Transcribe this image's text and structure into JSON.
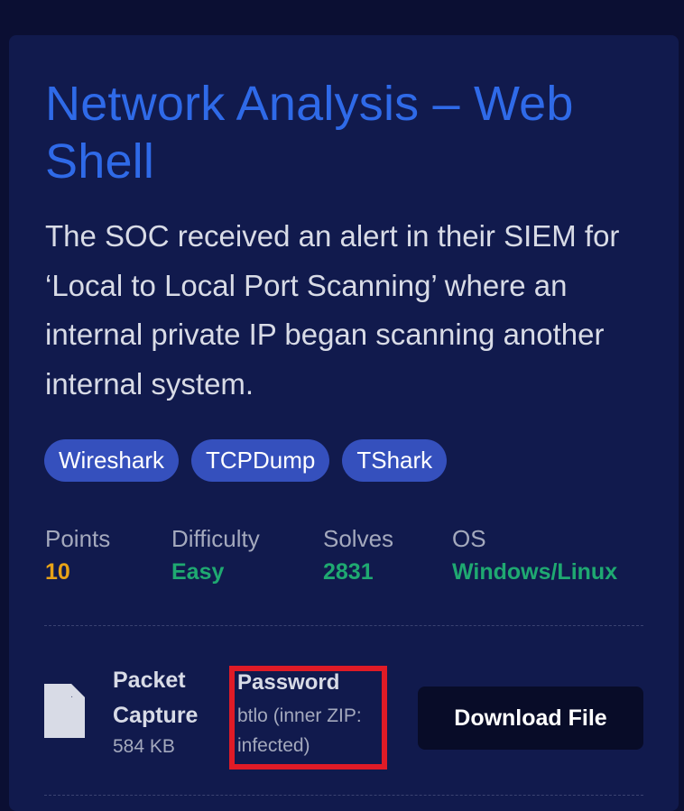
{
  "challenge": {
    "title": "Network Analysis – Web Shell",
    "description": "The SOC received an alert in their SIEM for ‘Local to Local Port Scanning’ where an internal private IP began scanning another internal system.",
    "tags": [
      "Wireshark",
      "TCPDump",
      "TShark"
    ]
  },
  "stats": [
    {
      "label": "Points",
      "value": "10",
      "color": "#e8a317"
    },
    {
      "label": "Difficulty",
      "value": "Easy",
      "color": "#1fa971"
    },
    {
      "label": "Solves",
      "value": "2831",
      "color": "#1fa971"
    },
    {
      "label": "OS",
      "value": "Windows/Linux",
      "color": "#1fa971"
    }
  ],
  "file": {
    "icon": "file-icon",
    "name": "Packet Capture",
    "size": "584 KB",
    "password_label": "Password",
    "password_value": "btlo (inner ZIP: infected)",
    "download_label": "Download File"
  },
  "colors": {
    "page_bg": "#0b0f33",
    "card_bg": "#111a4d",
    "title": "#2f6ae8",
    "tag_bg": "#3550bd",
    "highlight_border": "#e01b26"
  }
}
